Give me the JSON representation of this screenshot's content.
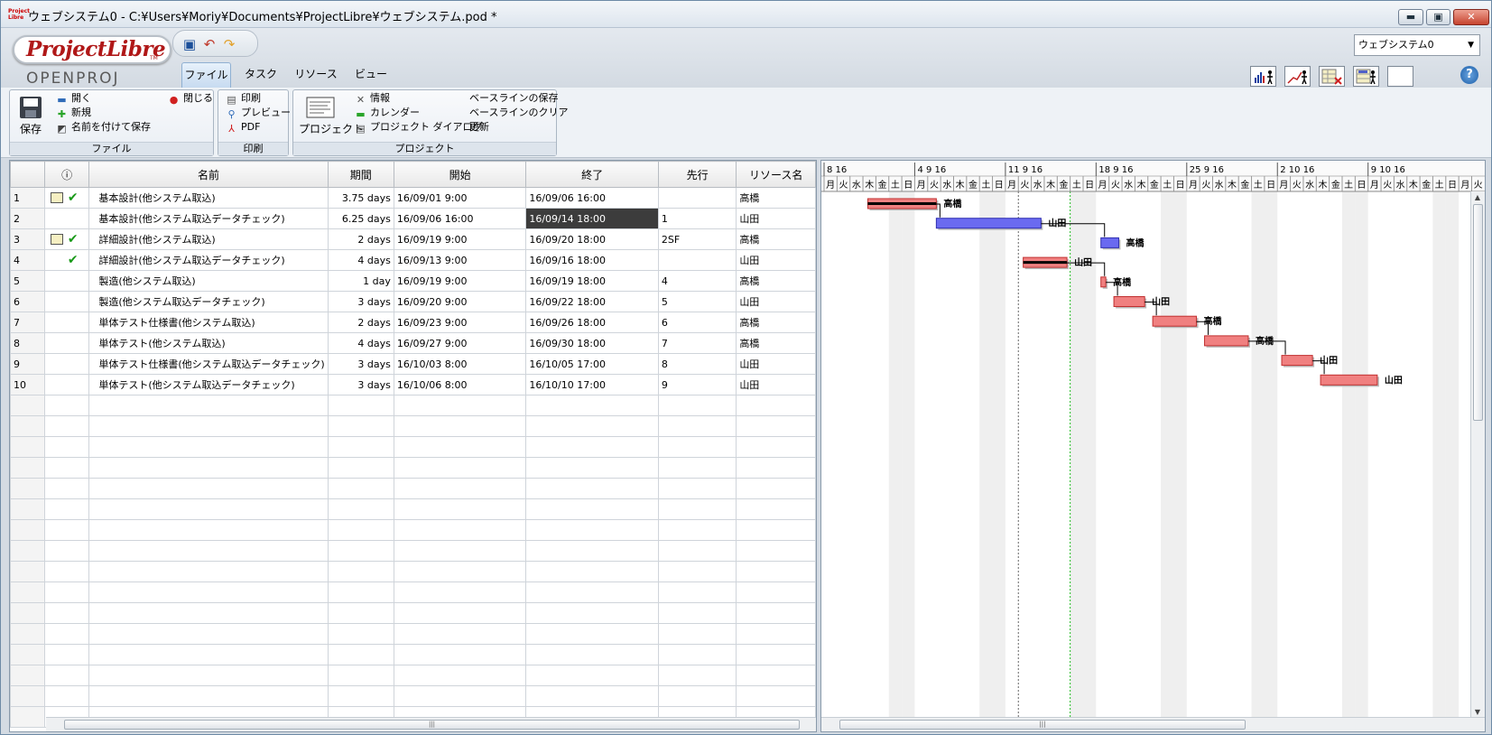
{
  "window": {
    "title": "ウェブシステム0 - C:¥Users¥Moriy¥Documents¥ProjectLibre¥ウェブシステム.pod *",
    "app_icon_text": "Project Libre",
    "minimize": "▬",
    "maximize": "▣",
    "close": "✕"
  },
  "logo": {
    "name": "ProjectLibre",
    "tm": "TM",
    "subtitle": "OPENPROJ"
  },
  "tabs": [
    "ファイル",
    "タスク",
    "リソース",
    "ビュー"
  ],
  "project_selector": {
    "value": "ウェブシステム0",
    "arrow": "▼"
  },
  "help": "?",
  "ribbon": {
    "file": {
      "label": "ファイル",
      "save": "保存",
      "open": "開く",
      "new": "新規",
      "save_as": "名前を付けて保存",
      "close": "閉じる"
    },
    "print": {
      "label": "印刷",
      "print": "印刷",
      "preview": "プレビュー",
      "pdf": "PDF"
    },
    "project": {
      "label": "プロジェクト",
      "project": "プロジェクト",
      "info": "情報",
      "calendar": "カレンダー",
      "project_dialog": "プロジェクト ダイアログ",
      "save_baseline": "ベースラインの保存",
      "clear_baseline": "ベースラインのクリア",
      "update": "更新"
    }
  },
  "grid": {
    "columns": [
      "",
      "ⓘ",
      "名前",
      "期間",
      "開始",
      "終了",
      "先行",
      "リソース名"
    ],
    "rows": [
      {
        "id": "1",
        "note": true,
        "done": true,
        "name": "基本設計(他システム取込)",
        "duration": "3.75 days",
        "start": "16/09/01 9:00",
        "end": "16/09/06 16:00",
        "pred": "",
        "resource": "高橋"
      },
      {
        "id": "2",
        "note": false,
        "done": false,
        "name": "基本設計(他システム取込データチェック)",
        "duration": "6.25 days",
        "start": "16/09/06 16:00",
        "end": "16/09/14 18:00",
        "pred": "1",
        "resource": "山田"
      },
      {
        "id": "3",
        "note": true,
        "done": true,
        "name": "詳細設計(他システム取込)",
        "duration": "2 days",
        "start": "16/09/19 9:00",
        "end": "16/09/20 18:00",
        "pred": "2SF",
        "resource": "高橋"
      },
      {
        "id": "4",
        "note": false,
        "done": true,
        "name": "詳細設計(他システム取込データチェック)",
        "duration": "4 days",
        "start": "16/09/13 9:00",
        "end": "16/09/16 18:00",
        "pred": "",
        "resource": "山田"
      },
      {
        "id": "5",
        "note": false,
        "done": false,
        "name": "製造(他システム取込)",
        "duration": "1 day",
        "start": "16/09/19 9:00",
        "end": "16/09/19 18:00",
        "pred": "4",
        "resource": "高橋"
      },
      {
        "id": "6",
        "note": false,
        "done": false,
        "name": "製造(他システム取込データチェック)",
        "duration": "3 days",
        "start": "16/09/20 9:00",
        "end": "16/09/22 18:00",
        "pred": "5",
        "resource": "山田"
      },
      {
        "id": "7",
        "note": false,
        "done": false,
        "name": "単体テスト仕様書(他システム取込)",
        "duration": "2 days",
        "start": "16/09/23 9:00",
        "end": "16/09/26 18:00",
        "pred": "6",
        "resource": "高橋"
      },
      {
        "id": "8",
        "note": false,
        "done": false,
        "name": "単体テスト(他システム取込)",
        "duration": "4 days",
        "start": "16/09/27 9:00",
        "end": "16/09/30 18:00",
        "pred": "7",
        "resource": "高橋"
      },
      {
        "id": "9",
        "note": false,
        "done": false,
        "name": "単体テスト仕様書(他システム取込データチェック)",
        "duration": "3 days",
        "start": "16/10/03 8:00",
        "end": "16/10/05 17:00",
        "pred": "8",
        "resource": "山田"
      },
      {
        "id": "10",
        "note": false,
        "done": false,
        "name": "単体テスト(他システム取込データチェック)",
        "duration": "3 days",
        "start": "16/10/06 8:00",
        "end": "16/10/10 17:00",
        "pred": "9",
        "resource": "山田"
      }
    ],
    "selected_cell": {
      "row": 2,
      "column": "終了"
    },
    "scroll_grip": "|||"
  },
  "gantt": {
    "weeks": [
      "8 16",
      "4 9 16",
      "11 9 16",
      "18 9 16",
      "25 9 16",
      "2 10 16",
      "9 10 16"
    ],
    "weekdays": [
      "月",
      "火",
      "水",
      "木",
      "金",
      "土",
      "日"
    ],
    "first_weekday_index": 0,
    "bars": [
      {
        "row": 1,
        "start": "2016-09-01T09:00",
        "end": "2016-09-06T16:00",
        "critical": true,
        "label": "高橋"
      },
      {
        "row": 2,
        "start": "2016-09-06T16:00",
        "end": "2016-09-14T18:00",
        "critical": false,
        "label": "山田"
      },
      {
        "row": 3,
        "start": "2016-09-19T09:00",
        "end": "2016-09-20T18:00",
        "critical": false,
        "label": "高橋"
      },
      {
        "row": 4,
        "start": "2016-09-13T09:00",
        "end": "2016-09-16T18:00",
        "critical": true,
        "label": "山田"
      },
      {
        "row": 5,
        "start": "2016-09-19T09:00",
        "end": "2016-09-19T18:00",
        "critical": true,
        "label": "高橋"
      },
      {
        "row": 6,
        "start": "2016-09-20T09:00",
        "end": "2016-09-22T18:00",
        "critical": true,
        "label": "山田"
      },
      {
        "row": 7,
        "start": "2016-09-23T09:00",
        "end": "2016-09-26T18:00",
        "critical": true,
        "label": "高橋"
      },
      {
        "row": 8,
        "start": "2016-09-27T09:00",
        "end": "2016-09-30T18:00",
        "critical": true,
        "label": "高橋"
      },
      {
        "row": 9,
        "start": "2016-10-03T08:00",
        "end": "2016-10-05T17:00",
        "critical": true,
        "label": "山田"
      },
      {
        "row": 10,
        "start": "2016-10-06T08:00",
        "end": "2016-10-10T17:00",
        "critical": true,
        "label": "山田"
      }
    ],
    "links": [
      [
        1,
        2
      ],
      [
        2,
        3
      ],
      [
        4,
        5
      ],
      [
        5,
        6
      ],
      [
        6,
        7
      ],
      [
        7,
        8
      ],
      [
        8,
        9
      ],
      [
        9,
        10
      ]
    ],
    "colors": {
      "critical": "#f08080",
      "normal": "#6a6af0",
      "weekend": "#e4e4e4"
    },
    "scroll_grip": "|||"
  }
}
